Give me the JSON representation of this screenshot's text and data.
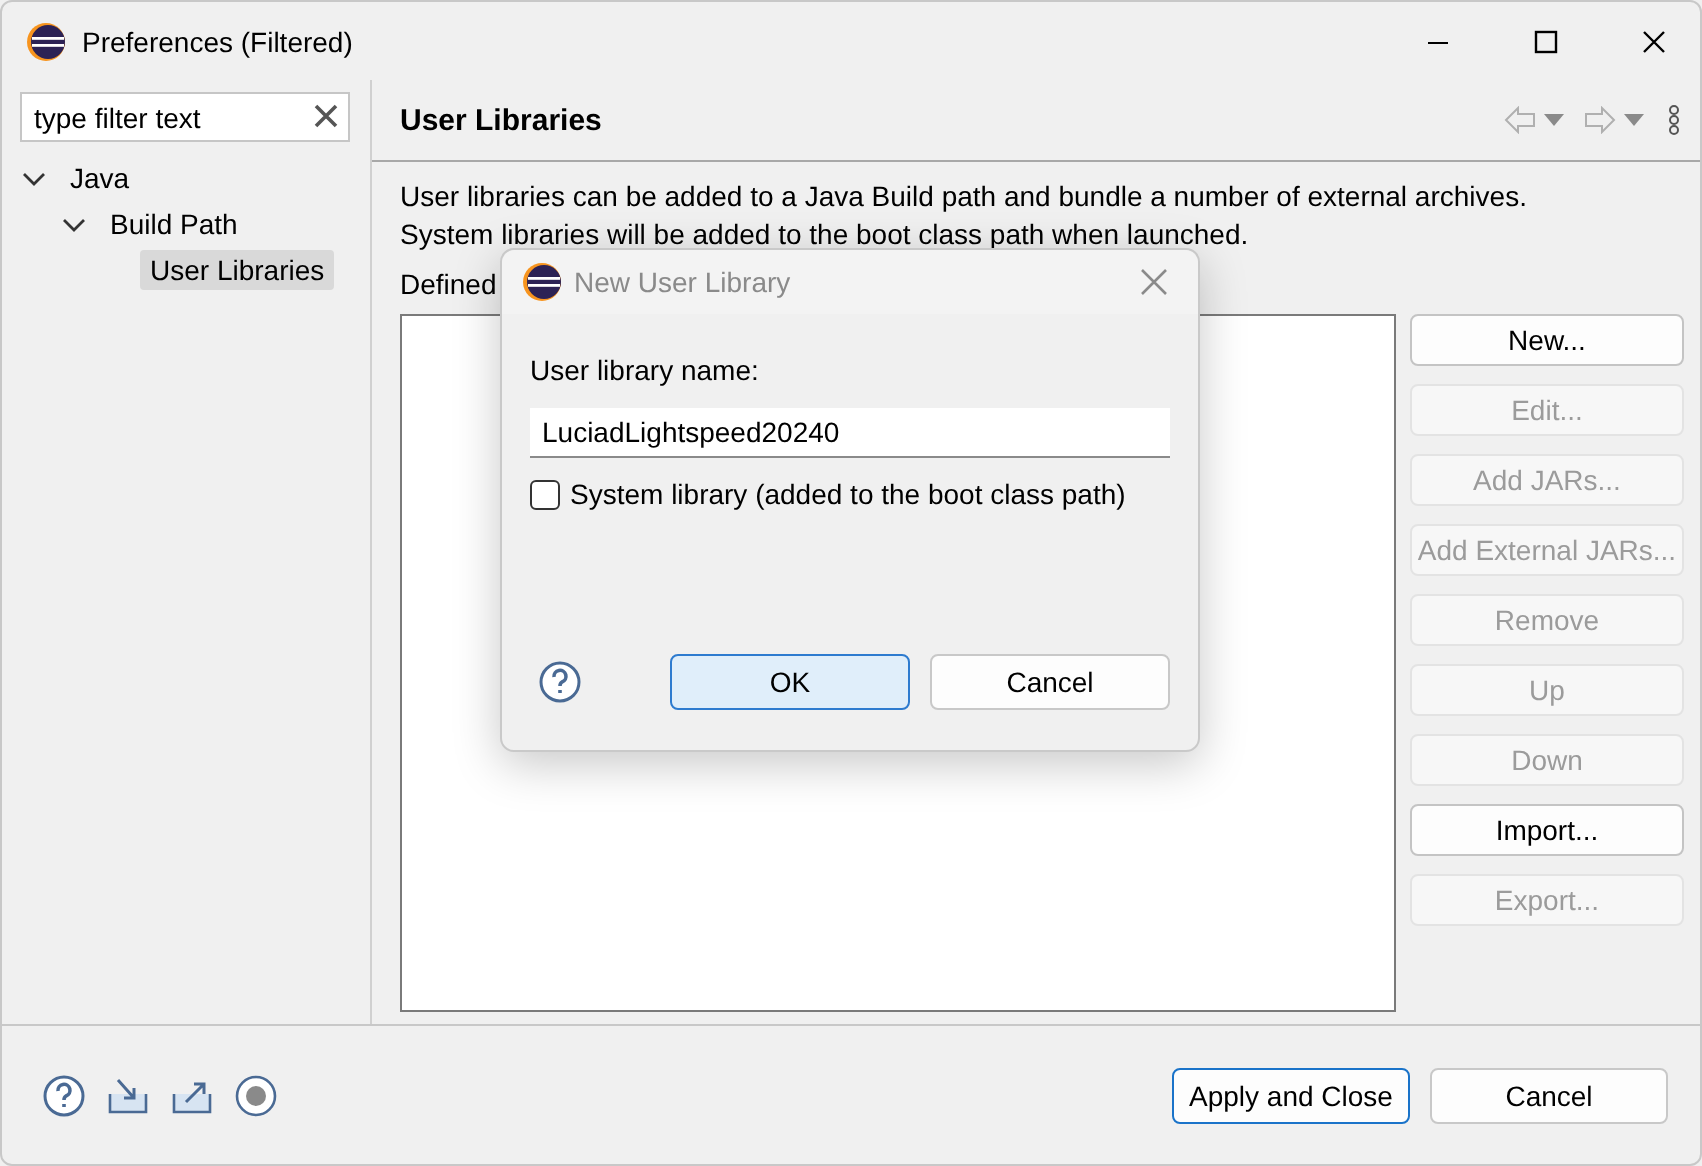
{
  "window": {
    "title": "Preferences (Filtered)"
  },
  "filter": {
    "placeholder": "type filter text"
  },
  "tree": [
    {
      "label": "Java",
      "expanded": true,
      "selected": false,
      "children": [
        {
          "label": "Build Path",
          "expanded": true,
          "selected": false,
          "children": [
            {
              "label": "User Libraries",
              "selected": true
            }
          ]
        }
      ]
    }
  ],
  "page": {
    "title": "User Libraries",
    "description": [
      "User libraries can be added to a Java Build path and bundle a number of external archives.",
      "System libraries will be added to the boot class path when launched."
    ],
    "list_label": "Defined",
    "button_groups": [
      [
        {
          "label": "New...",
          "disabled": false
        },
        {
          "label": "Edit...",
          "disabled": true
        },
        {
          "label": "Add JARs...",
          "disabled": true
        },
        {
          "label": "Add External JARs...",
          "disabled": true
        },
        {
          "label": "Remove",
          "disabled": true
        }
      ],
      [
        {
          "label": "Up",
          "disabled": true
        },
        {
          "label": "Down",
          "disabled": true
        }
      ],
      [
        {
          "label": "Import...",
          "disabled": false
        },
        {
          "label": "Export...",
          "disabled": true
        }
      ]
    ]
  },
  "dialog": {
    "title": "New User Library",
    "name_label": "User library name:",
    "name_value": "LuciadLightspeed20240",
    "system_library": {
      "label": "System library (added to the boot class path)",
      "checked": false
    },
    "buttons": [
      {
        "label": "OK",
        "default": true
      },
      {
        "label": "Cancel",
        "default": false
      }
    ]
  },
  "footer": {
    "buttons": [
      {
        "label": "Apply and Close",
        "default": true
      },
      {
        "label": "Cancel",
        "default": false
      }
    ]
  }
}
